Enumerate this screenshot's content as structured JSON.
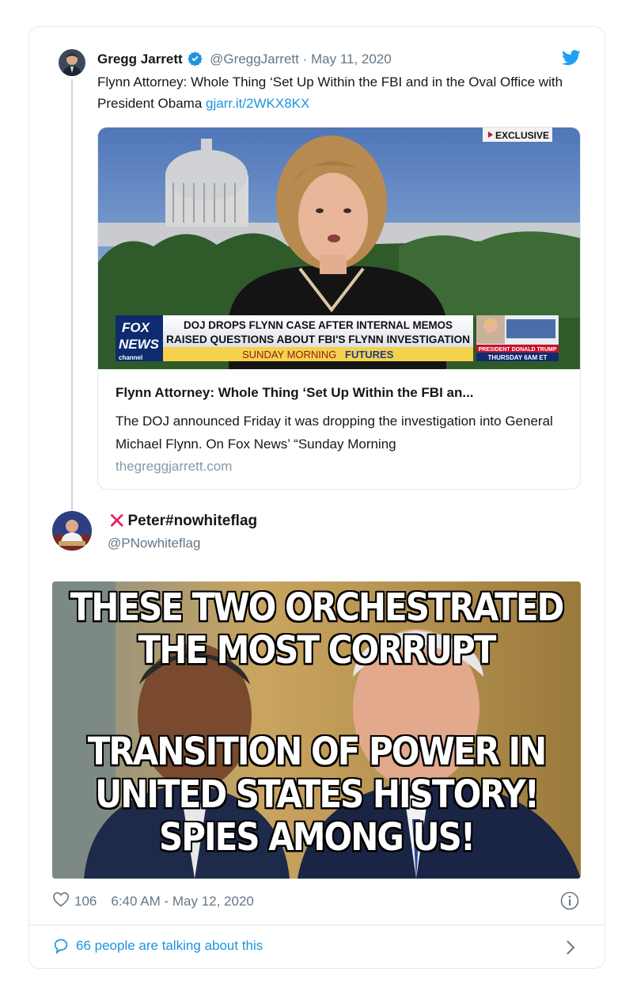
{
  "tweet_quoted": {
    "author_name": "Gregg Jarrett",
    "author_handle": "@GreggJarrett",
    "separator": "·",
    "date": "May 11, 2020",
    "text": "Flynn Attorney: Whole Thing ‘Set Up Within the FBI and in the Oval Office with President Obama",
    "link_text": "gjarr.it/2WKX8KX",
    "card": {
      "image_overlay": {
        "exclusive_badge": "EXCLUSIVE",
        "network_logo_top": "FOX",
        "network_logo_bottom": "NEWS",
        "network_logo_sub": "channel",
        "headline_line1": "DOJ DROPS FLYNN CASE AFTER INTERNAL MEMOS",
        "headline_line2": "RAISED QUESTIONS ABOUT FBI'S FLYNN INVESTIGATION",
        "show_name_part1": "SUNDAY MORNING",
        "show_name_part2": "FUTURES",
        "promo_line1": "PRESIDENT DONALD TRUMP",
        "promo_line2": "THURSDAY 6AM ET"
      },
      "title": "Flynn Attorney: Whole Thing ‘Set Up Within the FBI an...",
      "description": "The DOJ announced Friday it was dropping the investigation into General Michael Flynn. On Fox News’ “Sunday Morning",
      "domain": "thegreggjarrett.com"
    }
  },
  "tweet_main": {
    "author_name": "Peter#nowhiteflag",
    "author_handle": "@PNowhiteflag",
    "meme_lines": [
      "THESE TWO ORCHESTRATED",
      "THE MOST CORRUPT",
      "TRANSITION OF POWER IN",
      "UNITED STATES HISTORY!",
      "SPIES AMONG US!"
    ],
    "likes": "106",
    "timestamp": "6:40 AM - May 12, 2020"
  },
  "footer": {
    "talking_text": "66 people are talking about this"
  },
  "colors": {
    "accent_blue": "#1b95e0",
    "muted_gray": "#657786",
    "border": "#e1e8ed",
    "red_x": "#e0245e"
  },
  "icons": {
    "twitter": "twitter-bird-icon",
    "verified": "verified-badge-icon",
    "heart": "heart-icon",
    "info": "info-icon",
    "comment": "comment-bubble-icon",
    "chevron": "chevron-right-icon"
  }
}
